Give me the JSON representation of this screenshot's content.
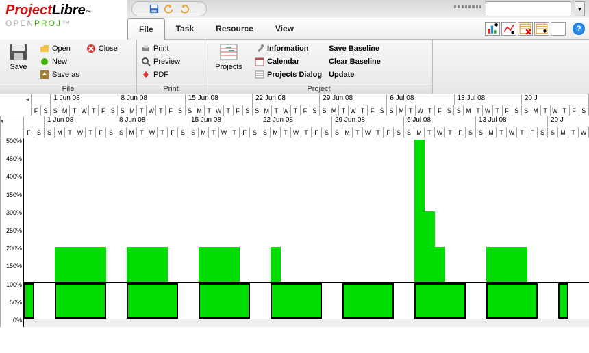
{
  "logo": {
    "part1": "Project",
    "part2": "Libre",
    "tm": "™",
    "sub1": "OPEN",
    "sub2": "PROJ",
    "sub_tm": "™"
  },
  "tabs": {
    "file": "File",
    "task": "Task",
    "resource": "Resource",
    "view": "View"
  },
  "ribbon": {
    "file_group": "File",
    "save": "Save",
    "open": "Open",
    "close": "Close",
    "new": "New",
    "save_as": "Save as",
    "print_group": "Print",
    "print": "Print",
    "preview": "Preview",
    "pdf": "PDF",
    "project_group": "Project",
    "projects": "Projects",
    "information": "Information",
    "calendar": "Calendar",
    "projects_dialog": "Projects Dialog",
    "save_baseline": "Save Baseline",
    "clear_baseline": "Clear Baseline",
    "update": "Update"
  },
  "timeline": {
    "weeks": [
      "1 Jun 08",
      "8 Jun 08",
      "15 Jun 08",
      "22 Jun 08",
      "29 Jun 08",
      "6 Jul 08",
      "13 Jul 08",
      "20 J"
    ],
    "first_days": [
      "F",
      "S"
    ],
    "days_pattern": [
      "S",
      "M",
      "T",
      "W",
      "T",
      "F",
      "S"
    ]
  },
  "chart_data": {
    "type": "bar",
    "ylabel_suffix": "%",
    "ylim": [
      0,
      500
    ],
    "yticks": [
      0,
      50,
      100,
      150,
      200,
      250,
      300,
      350,
      400,
      450,
      500
    ],
    "threshold": 100,
    "x_days": [
      "F",
      "S",
      "S",
      "M",
      "T",
      "W",
      "T",
      "F",
      "S",
      "S",
      "M",
      "T",
      "W",
      "T",
      "F",
      "S",
      "S",
      "M",
      "T",
      "W",
      "T",
      "F",
      "S",
      "S",
      "M",
      "T",
      "W",
      "T",
      "F",
      "S",
      "S",
      "M",
      "T",
      "W",
      "T",
      "F",
      "S",
      "S",
      "M",
      "T",
      "W",
      "T",
      "F",
      "S",
      "S",
      "M",
      "T",
      "W",
      "T",
      "F",
      "S",
      "S",
      "M"
    ],
    "values": [
      100,
      0,
      0,
      200,
      200,
      200,
      200,
      200,
      0,
      0,
      200,
      200,
      200,
      200,
      100,
      0,
      0,
      200,
      200,
      200,
      200,
      100,
      0,
      0,
      200,
      100,
      100,
      100,
      100,
      0,
      0,
      100,
      100,
      100,
      100,
      100,
      0,
      0,
      500,
      300,
      200,
      100,
      100,
      0,
      0,
      200,
      200,
      200,
      200,
      100,
      0,
      0,
      100
    ],
    "highlight_threshold_per_week": true
  }
}
